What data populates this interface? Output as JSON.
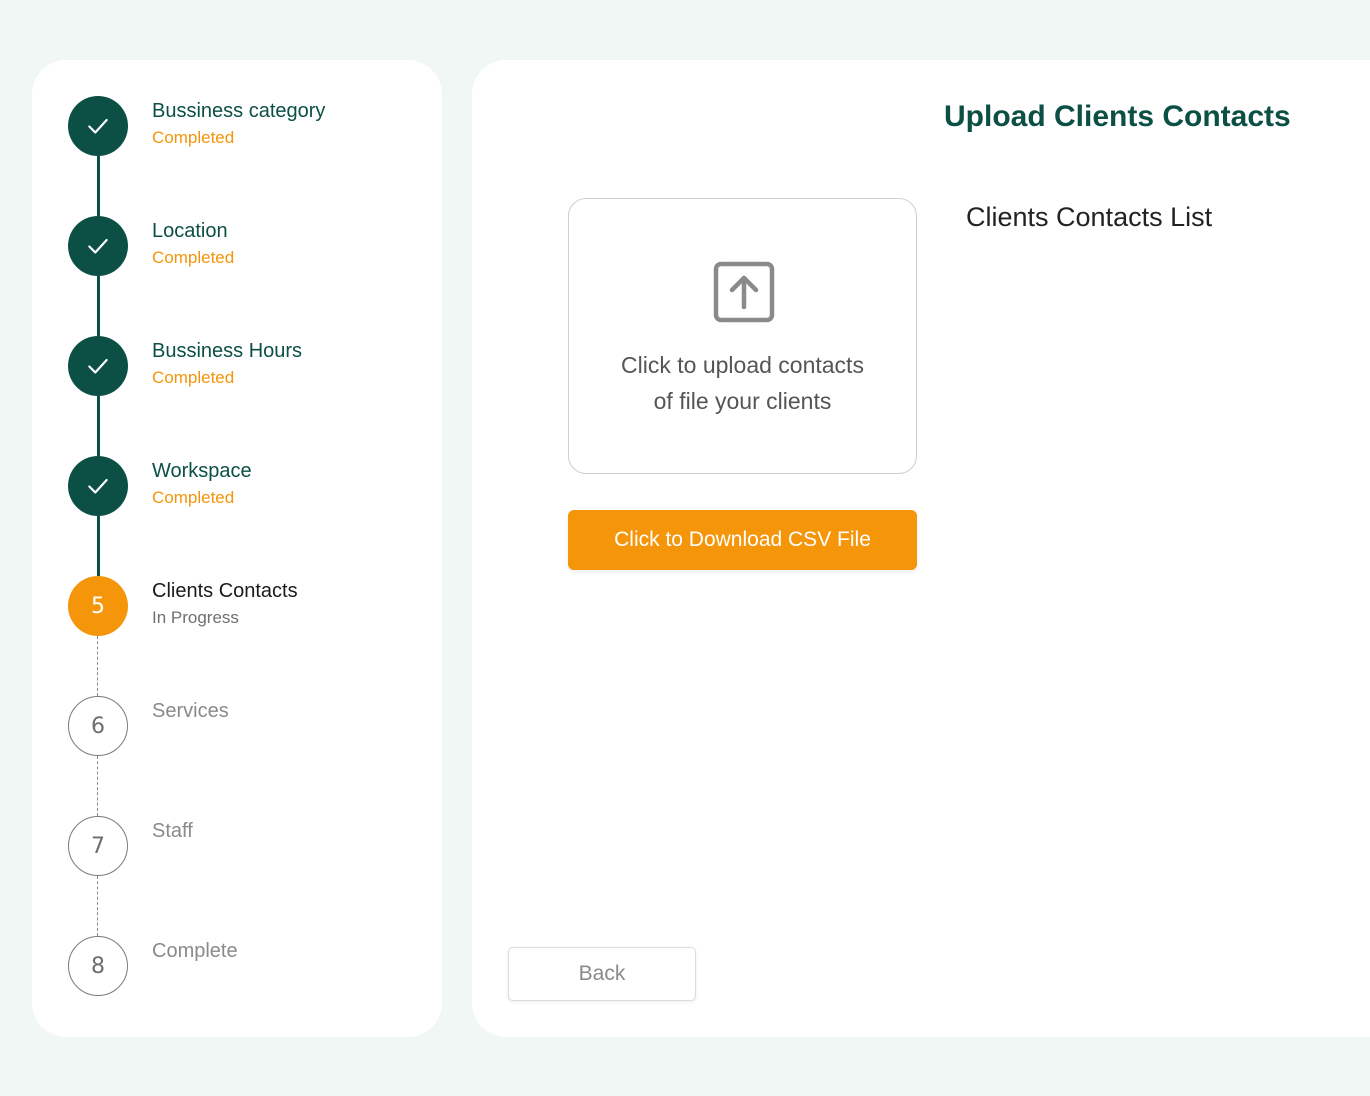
{
  "steps": [
    {
      "title": "Bussiness category",
      "status": "Completed",
      "state": "done"
    },
    {
      "title": "Location",
      "status": "Completed",
      "state": "done"
    },
    {
      "title": "Bussiness Hours",
      "status": "Completed",
      "state": "done"
    },
    {
      "title": "Workspace",
      "status": "Completed",
      "state": "done"
    },
    {
      "title": "Clients Contacts",
      "status": "In Progress",
      "state": "current",
      "number": "5"
    },
    {
      "title": "Services",
      "status": "",
      "state": "todo",
      "number": "6"
    },
    {
      "title": "Staff",
      "status": "",
      "state": "todo",
      "number": "7"
    },
    {
      "title": "Complete",
      "status": "",
      "state": "todo",
      "number": "8"
    }
  ],
  "main": {
    "title": "Upload Clients Contacts",
    "upload_line1": "Click to upload contacts",
    "upload_line2": "of file your clients",
    "upload_icon": "upload-arrow-icon",
    "download_label": "Click to Download CSV File",
    "list_title": "Clients Contacts List",
    "back_label": "Back"
  },
  "colors": {
    "primary": "#0b4f45",
    "accent": "#f5950a",
    "background": "#f0f7f5"
  }
}
